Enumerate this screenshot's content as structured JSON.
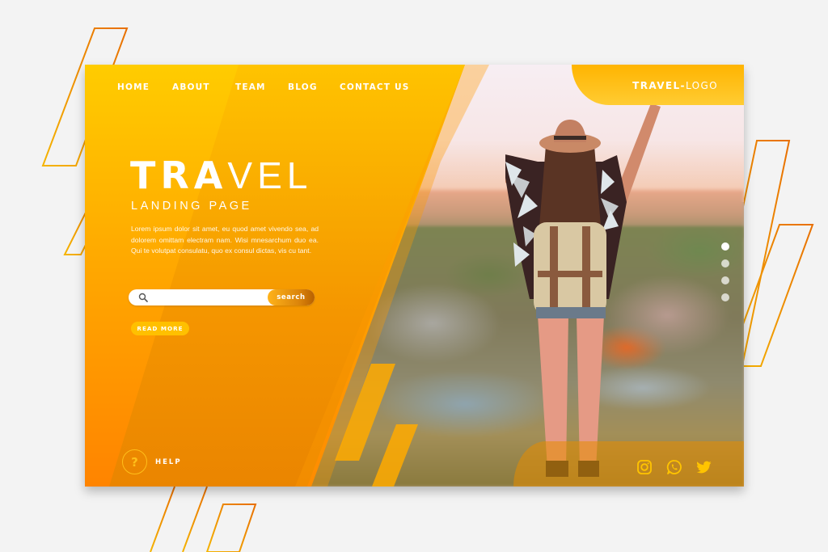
{
  "nav": {
    "items": [
      {
        "label": "HOME"
      },
      {
        "label": "ABOUT"
      },
      {
        "label": "TEAM"
      },
      {
        "label": "BLOG"
      },
      {
        "label": "CONTACT US"
      }
    ]
  },
  "logo": {
    "bold": "TRAVEL",
    "separator": "-",
    "light": "LOGO"
  },
  "hero": {
    "title_bold": "TRA",
    "title_light": "VEL",
    "subtitle": "LANDING PAGE",
    "body": "Lorem ipsum dolor sit amet, eu quod amet vivendo sea, ad dolorem omittam electram nam. Wisi mnesarchum duo ea. Qui te volutpat consulatu, quo ex consul dictas, vis cu tant."
  },
  "search": {
    "value": "",
    "placeholder": "",
    "button_label": "search",
    "icon": "search-icon"
  },
  "read_more": {
    "label": "READ MORE"
  },
  "help": {
    "icon_glyph": "?",
    "label": "HELP"
  },
  "slider": {
    "count": 4,
    "active_index": 0
  },
  "social": {
    "icons": [
      "instagram-icon",
      "whatsapp-icon",
      "twitter-icon"
    ]
  },
  "colors": {
    "background": "#f3f3f3",
    "accent_yellow": "#ffc000",
    "accent_orange": "#f08a00",
    "deco_line_start": "#f5b400",
    "deco_line_end": "#e86f00"
  }
}
